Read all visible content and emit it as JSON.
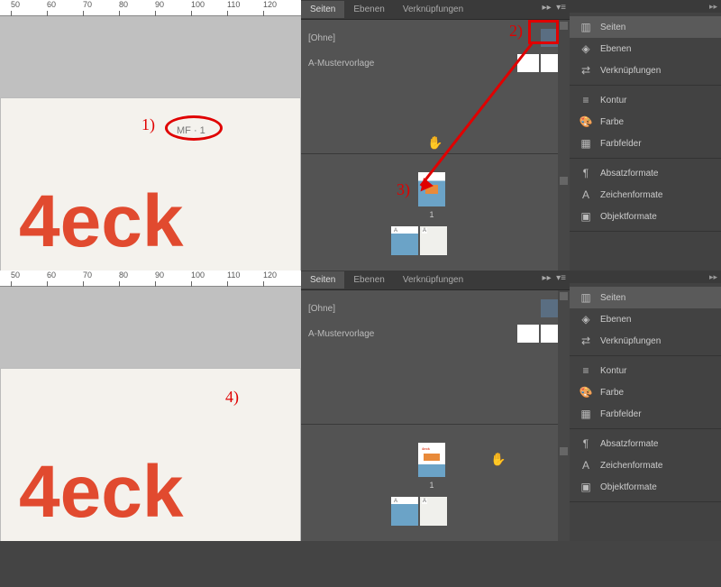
{
  "ruler_marks": [
    "50",
    "60",
    "70",
    "80",
    "90",
    "100",
    "110",
    "120"
  ],
  "mf_badge": "MF · 1",
  "big_text": "4eck",
  "annotations": {
    "a1": "1)",
    "a2": "2)",
    "a3": "3)",
    "a4": "4)"
  },
  "panel_tabs": {
    "seiten": "Seiten",
    "ebenen": "Ebenen",
    "verknup": "Verknüpfungen"
  },
  "masters": {
    "ohne": "[Ohne]",
    "muster": "A-Mustervorlage"
  },
  "page_number": "1",
  "tiny_a": "A",
  "sidebar": {
    "g1": {
      "seiten": "Seiten",
      "ebenen": "Ebenen",
      "verknup": "Verknüpfungen"
    },
    "g2": {
      "kontur": "Kontur",
      "farbe": "Farbe",
      "farbfelder": "Farbfelder"
    },
    "g3": {
      "absatz": "Absatzformate",
      "zeichen": "Zeichenformate",
      "objekt": "Objektformate"
    }
  }
}
